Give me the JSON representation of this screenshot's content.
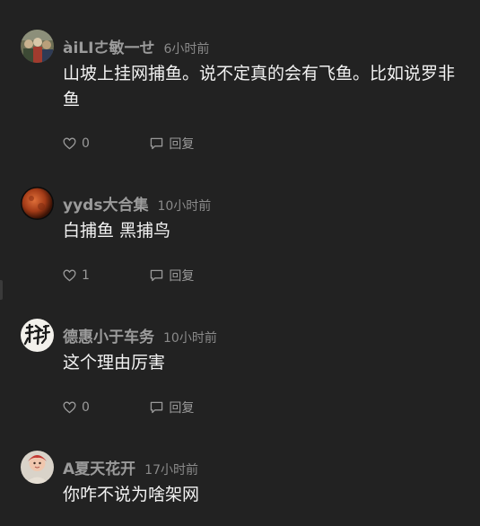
{
  "comments": [
    {
      "username": "àiLⅠㄜ敏一せ",
      "time": "6小时前",
      "text": "山坡上挂网捕鱼。说不定真的会有飞鱼。比如说罗非鱼",
      "likes": "0",
      "reply_label": "回复",
      "avatar": "group-photo-avatar"
    },
    {
      "username": "yyds大合集",
      "time": "10小时前",
      "text": "白捕鱼 黑捕鸟",
      "likes": "1",
      "reply_label": "回复",
      "avatar": "red-moon-avatar"
    },
    {
      "username": "德惠小于车务",
      "time": "10小时前",
      "text": "这个理由厉害",
      "likes": "0",
      "reply_label": "回复",
      "avatar": "calligraphy-avatar"
    },
    {
      "username": "A夏天花开",
      "time": "17小时前",
      "text": "你咋不说为啥架网",
      "avatar": "child-photo-avatar"
    }
  ],
  "icons": {
    "like": "heart-outline-icon",
    "reply": "comment-bubble-icon"
  },
  "colors": {
    "background": "#222222",
    "username": "#9b9b9b",
    "text": "#f2f2f2",
    "meta": "#8a8a8a"
  }
}
